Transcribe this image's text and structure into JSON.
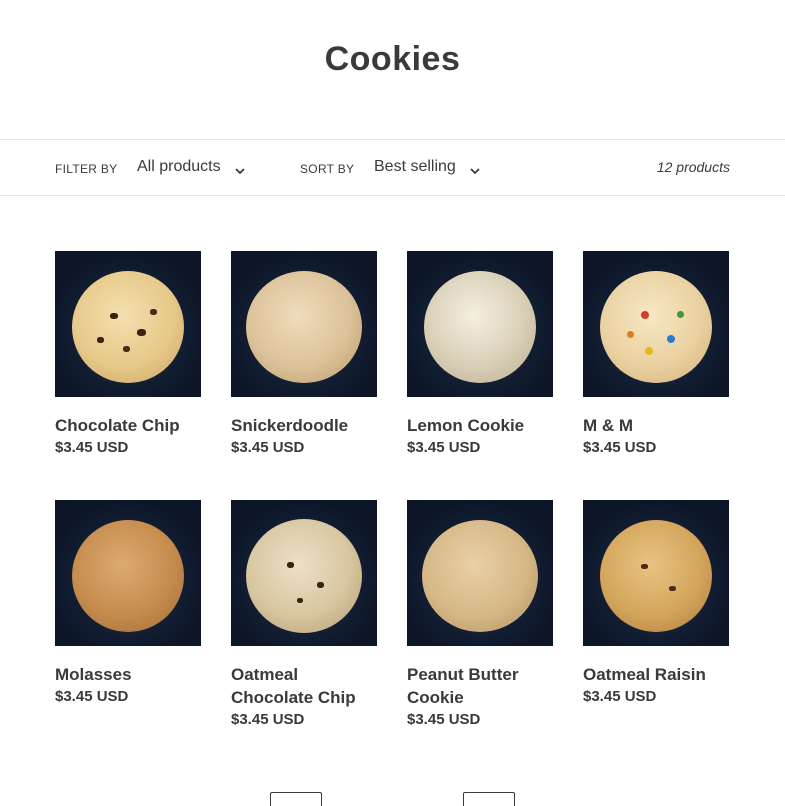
{
  "page": {
    "title": "Cookies"
  },
  "filter_bar": {
    "filter_label": "Filter by",
    "filter_value": "All products",
    "sort_label": "Sort by",
    "sort_value": "Best selling",
    "product_count": "12 products"
  },
  "products": [
    {
      "name": "Chocolate Chip",
      "price": "$3.45 USD",
      "image_icon": "chocolate-chip-cookie-photo"
    },
    {
      "name": "Snickerdoodle",
      "price": "$3.45 USD",
      "image_icon": "snickerdoodle-cookie-photo"
    },
    {
      "name": "Lemon Cookie",
      "price": "$3.45 USD",
      "image_icon": "lemon-cookie-photo"
    },
    {
      "name": "M & M",
      "price": "$3.45 USD",
      "image_icon": "m-and-m-cookie-photo"
    },
    {
      "name": "Molasses",
      "price": "$3.45 USD",
      "image_icon": "molasses-cookie-photo"
    },
    {
      "name": "Oatmeal Chocolate Chip",
      "price": "$3.45 USD",
      "image_icon": "oatmeal-chocolate-chip-cookie-photo"
    },
    {
      "name": "Peanut Butter Cookie",
      "price": "$3.45 USD",
      "image_icon": "peanut-butter-cookie-photo"
    },
    {
      "name": "Oatmeal Raisin",
      "price": "$3.45 USD",
      "image_icon": "oatmeal-raisin-cookie-photo"
    }
  ],
  "colors": {
    "text": "#3a3a3a",
    "border": "#e8e8e1",
    "photo_background": "#13203a"
  }
}
